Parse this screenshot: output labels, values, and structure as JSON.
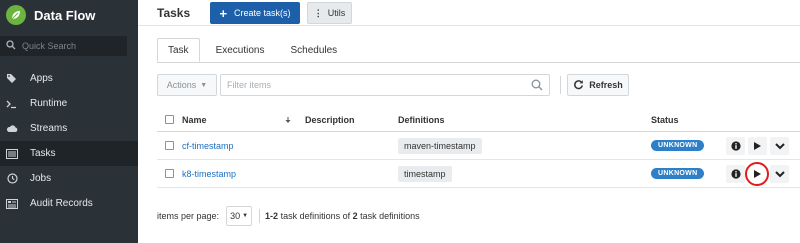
{
  "app": {
    "title": "Data Flow"
  },
  "search": {
    "placeholder": "Quick Search"
  },
  "sidebar": {
    "items": [
      {
        "label": "Apps"
      },
      {
        "label": "Runtime"
      },
      {
        "label": "Streams"
      },
      {
        "label": "Tasks"
      },
      {
        "label": "Jobs"
      },
      {
        "label": "Audit Records"
      }
    ]
  },
  "header": {
    "title": "Tasks",
    "create_label": "Create task(s)",
    "utils_label": "Utils"
  },
  "tabs": [
    {
      "label": "Task"
    },
    {
      "label": "Executions"
    },
    {
      "label": "Schedules"
    }
  ],
  "toolbar": {
    "actions_label": "Actions",
    "filter_placeholder": "Filter items",
    "refresh_label": "Refresh"
  },
  "table": {
    "columns": {
      "name": "Name",
      "description": "Description",
      "definitions": "Definitions",
      "status": "Status"
    },
    "rows": [
      {
        "name": "cf-timestamp",
        "description": "",
        "definition": "maven-timestamp",
        "status": "UNKNOWN"
      },
      {
        "name": "k8-timestamp",
        "description": "",
        "definition": "timestamp",
        "status": "UNKNOWN"
      }
    ]
  },
  "footer": {
    "per_page_label": "items per page:",
    "per_page_value": "30",
    "range": "1-2",
    "summary_mid": " task definitions of ",
    "total": "2",
    "summary_end": " task definitions"
  },
  "colors": {
    "sidebar_bg": "#2a3137",
    "primary": "#1d5fa8",
    "status_unknown": "#2d80c8",
    "link": "#1d6fc0",
    "highlight": "#e01b1b"
  },
  "icons": {
    "logo": "spring-leaf-icon",
    "search": "search-icon",
    "apps": "tags-icon",
    "runtime": "terminal-icon",
    "streams": "cloud-icon",
    "tasks": "list-icon",
    "jobs": "clock-icon",
    "audit": "audit-icon",
    "row_info": "info-icon",
    "row_launch": "play-icon",
    "row_more": "chevron-down-icon"
  }
}
